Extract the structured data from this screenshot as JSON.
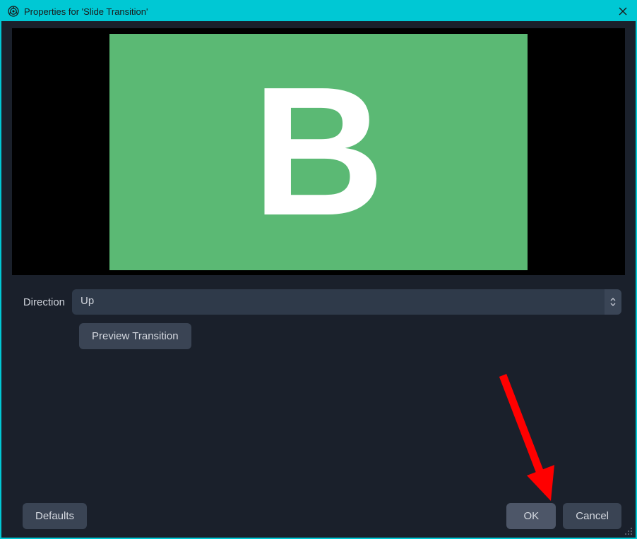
{
  "titlebar": {
    "title": "Properties for 'Slide Transition'"
  },
  "preview": {
    "letter": "B"
  },
  "form": {
    "direction_label": "Direction",
    "direction_value": "Up",
    "preview_button": "Preview Transition"
  },
  "footer": {
    "defaults": "Defaults",
    "ok": "OK",
    "cancel": "Cancel"
  }
}
